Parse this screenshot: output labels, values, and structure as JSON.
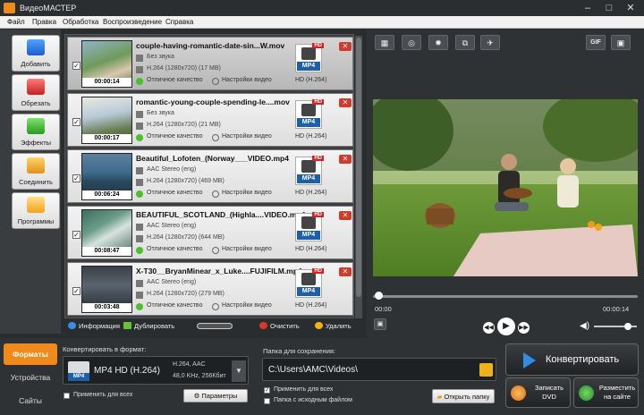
{
  "app": {
    "title": "ВидеоМАСТЕР"
  },
  "menu": [
    "Файл",
    "Правка",
    "Обработка",
    "Воспроизведение",
    "Справка"
  ],
  "tools": [
    {
      "label": "Добавить",
      "icon": "add-film-icon"
    },
    {
      "label": "Обрезать",
      "icon": "scissors-icon"
    },
    {
      "label": "Эффекты",
      "icon": "effects-icon"
    },
    {
      "label": "Соединить",
      "icon": "join-icon"
    },
    {
      "label": "Программы",
      "icon": "programs-icon"
    }
  ],
  "files": [
    {
      "name": "couple-having-romantic-date-sin...W.mov",
      "audio": "Без звука",
      "video": "H.264 (1280x720) (17 MB)",
      "duration": "00:00:14",
      "quality": "Отличное качество",
      "settings": "Настройки видео",
      "format": "HD (H.264)",
      "badge": "MP4",
      "hd": "HD",
      "checked": "✓"
    },
    {
      "name": "romantic-young-couple-spending-le....mov",
      "audio": "Без звука",
      "video": "H.264 (1280x720) (21 MB)",
      "duration": "00:00:17",
      "quality": "Отличное качество",
      "settings": "Настройки видео",
      "format": "HD (H.264)",
      "badge": "MP4",
      "hd": "HD",
      "checked": "✓"
    },
    {
      "name": "Beautiful_Lofoten_(Norway___VIDEO.mp4",
      "audio": "AAC Stereo (eng)",
      "video": "H.264 (1280x720) (469 MB)",
      "duration": "00:06:24",
      "quality": "Отличное качество",
      "settings": "Настройки видео",
      "format": "HD (H.264)",
      "badge": "MP4",
      "hd": "HD",
      "checked": "✓"
    },
    {
      "name": "BEAUTIFUL_SCOTLAND_(Highla....VIDEO.mp4",
      "audio": "AAC Stereo (eng)",
      "video": "H.264 (1280x720) (644 MB)",
      "duration": "00:08:47",
      "quality": "Отличное качество",
      "settings": "Настройки видео",
      "format": "HD (H.264)",
      "badge": "MP4",
      "hd": "HD",
      "checked": "✓"
    },
    {
      "name": "X-T30__BryanMinear_x_Luke....FUJIFILM.mp4",
      "audio": "AAC Stereo (eng)",
      "video": "H.264 (1280x720) (279 MB)",
      "duration": "00:03:48",
      "quality": "Отличное качество",
      "settings": "Настройки видео",
      "format": "HD (H.264)",
      "badge": "MP4",
      "hd": "HD",
      "checked": "✓"
    }
  ],
  "list_tools": {
    "info": "Информация",
    "duplicate": "Дублировать",
    "clear": "Очистить",
    "delete": "Удалить"
  },
  "player": {
    "current_time": "00:00",
    "total_time": "00:00:14",
    "gif": "GIF",
    "volume": 0.8,
    "position": 0.0
  },
  "bottom": {
    "tabs": [
      "Форматы",
      "Устройства",
      "Сайты"
    ],
    "convert_to_label": "Конвертировать в формат:",
    "format_name": "MP4 HD (H.264)",
    "format_codec": "H.264, AAC",
    "format_audio": "48,0 KHz, 256Кбит",
    "apply_all": "Применить для всех",
    "params": "Параметры",
    "folder_label": "Папка для сохранения:",
    "folder_path": "C:\\Users\\AMC\\Videos\\",
    "apply_all2": "Применить для всех",
    "source_folder": "Папка с исходным файлом",
    "open_folder": "Открыть папку",
    "convert": "Конвертировать",
    "burn_dvd": "Записать DVD",
    "upload": "Разместить на сайте"
  },
  "colors": {
    "accent": "#f08a1c",
    "mp4_badge": "#1e5fa8",
    "delete_red": "#d23a2a"
  }
}
